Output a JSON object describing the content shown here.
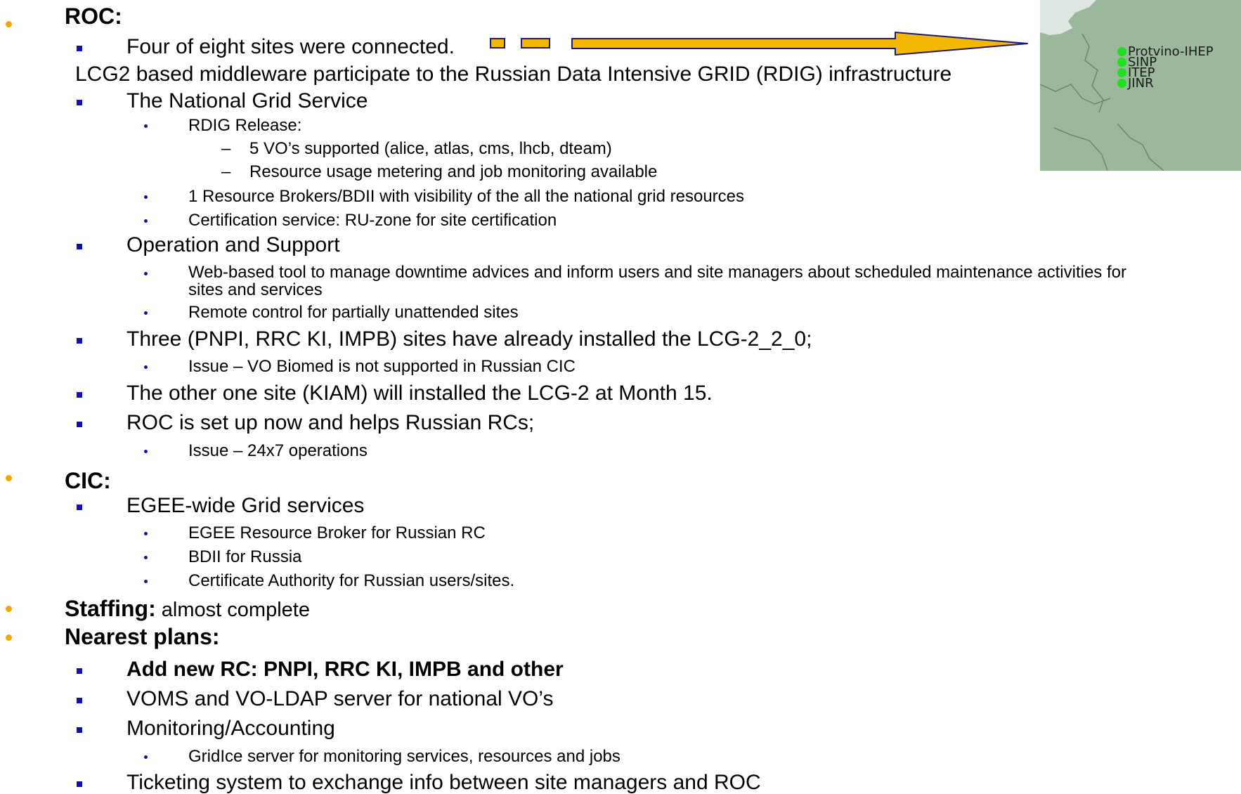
{
  "colors": {
    "bullet_level1": "#f0a800",
    "bullet_level2": "#1010b0",
    "arrow_fill": "#f5b800",
    "map_land": "#9cb89c",
    "site_dot": "#22dd22"
  },
  "roc": {
    "heading": "ROC:",
    "sites_connected": "Four of eight sites were connected.",
    "lcg2_note": "LCG2 based  middleware participate to the Russian Data Intensive GRID (RDIG) infrastructure",
    "national_grid": {
      "label": "The National Grid Service",
      "rdig_release": "RDIG Release:",
      "vos": "5 VO’s  supported  (alice, atlas, cms, lhcb, dteam)",
      "metering": "Resource usage metering and job monitoring available",
      "brokers": "1 Resource Brokers/BDII  with visibility of the all the national grid resources",
      "certification": "Certification service: RU-zone for site certification"
    },
    "operation": {
      "label": "Operation and Support",
      "web_tool_line1": "Web-based tool  to manage downtime advices and inform users and site managers about scheduled maintenance activities for",
      "web_tool_line2": "sites and services",
      "remote": "Remote control for partially unattended sites"
    },
    "three_sites": "Three (PNPI, RRC KI, IMPB) sites have already installed the LCG-2_2_0;",
    "issue_biomed": "Issue – VO Biomed is not supported in Russian CIC",
    "other_site": "The other one site (KIAM) will installed the LCG-2 at Month 15.",
    "roc_setup": "ROC is set up now and helps Russian RCs;",
    "issue_24x7": "Issue – 24x7 operations"
  },
  "cic": {
    "heading": "CIC:",
    "egee_wide": "EGEE-wide Grid services",
    "rb": "EGEE Resource Broker for Russian RC",
    "bdii": "BDII  for Russia",
    "ca": "Certificate Authority for Russian users/sites."
  },
  "staffing": {
    "heading": "Staffing:",
    "text": " almost complete"
  },
  "plans": {
    "heading": "Nearest plans:",
    "add_rc": "Add new RC: PNPI, RRC KI, IMPB and other",
    "voms": "VOMS and VO-LDAP server for national  VO’s",
    "monitoring": "Monitoring/Accounting",
    "gridice": "GridIce server for monitoring services, resources and jobs",
    "ticketing": "Ticketing system to exchange info between  site managers and ROC"
  },
  "map": {
    "sites": [
      "Protvino-IHEP",
      "SINP",
      "ITEP",
      "JINR"
    ]
  }
}
